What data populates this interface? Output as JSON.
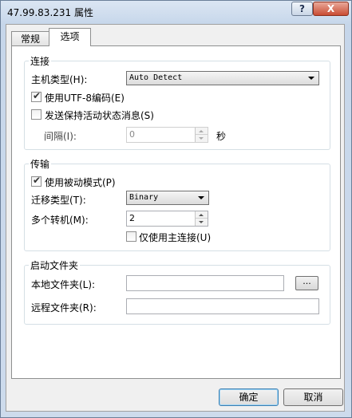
{
  "window": {
    "title": "47.99.83.231 属性",
    "help_button": "?",
    "close_button": "X"
  },
  "tabs": [
    {
      "label": "常规"
    },
    {
      "label": "选项"
    }
  ],
  "connection": {
    "group_label": "连接",
    "host_type_label": "主机类型(H):",
    "host_type_value": "Auto Detect",
    "utf8_label": "使用UTF-8编码(E)",
    "utf8_checked": true,
    "keepalive_label": "发送保持活动状态消息(S)",
    "keepalive_checked": false,
    "interval_label": "间隔(I):",
    "interval_value": "0",
    "interval_unit": "秒"
  },
  "transfer": {
    "group_label": "传输",
    "passive_label": "使用被动模式(P)",
    "passive_checked": true,
    "transfer_type_label": "迁移类型(T):",
    "transfer_type_value": "Binary",
    "multi_conn_label": "多个转机(M):",
    "multi_conn_value": "2",
    "main_only_label": "仅使用主连接(U)",
    "main_only_checked": false
  },
  "startup": {
    "group_label": "启动文件夹",
    "local_label": "本地文件夹(L):",
    "local_value": "",
    "browse_label": "...",
    "remote_label": "远程文件夹(R):",
    "remote_value": ""
  },
  "buttons": {
    "ok": "确定",
    "cancel": "取消"
  }
}
